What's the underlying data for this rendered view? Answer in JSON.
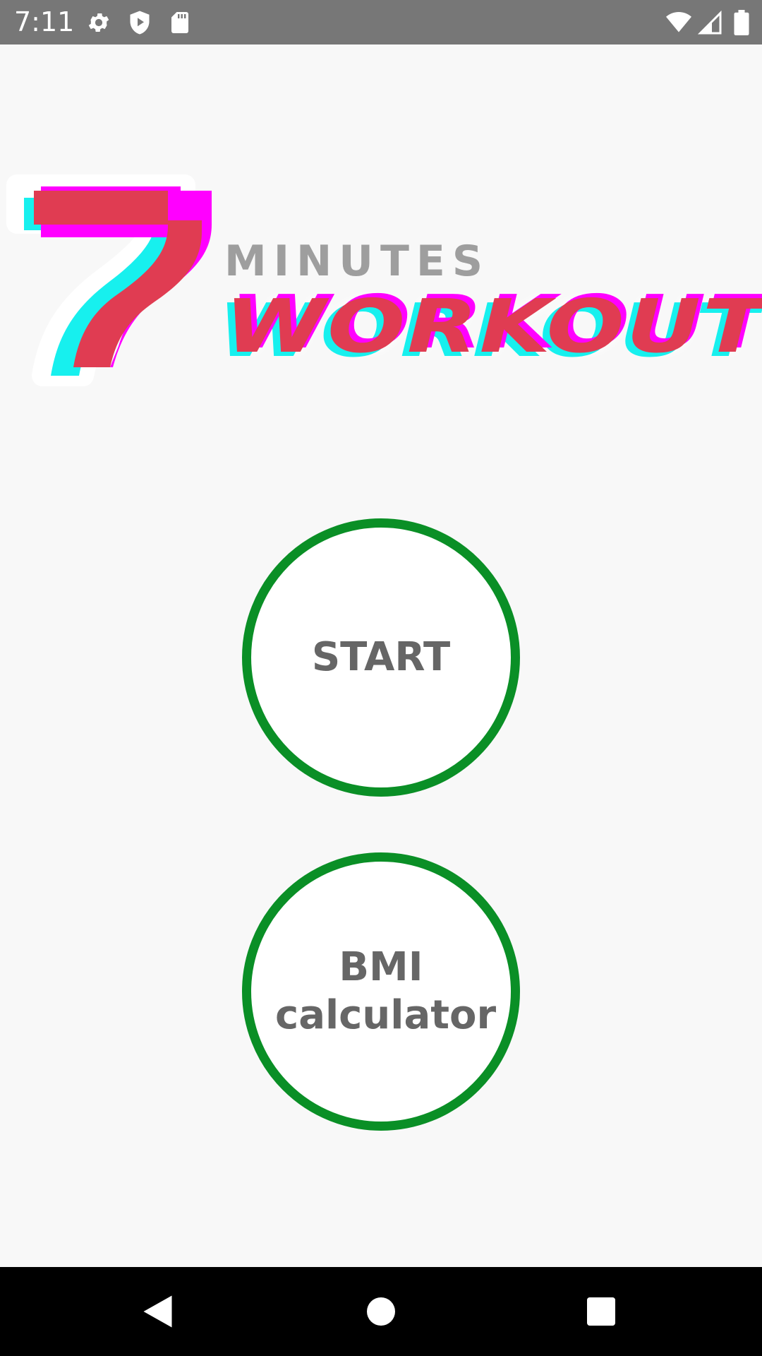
{
  "status_bar": {
    "time": "7:11",
    "left_icons": [
      "gear-icon",
      "shield-play-icon",
      "sd-card-icon"
    ],
    "right_icons": [
      "wifi-icon",
      "cell-signal-icon",
      "battery-icon"
    ]
  },
  "logo": {
    "number": "7",
    "minutes_text": "MINUTES",
    "workout_text": "WORKOUT",
    "colors": {
      "primary": "#e03c52",
      "magenta": "#ff00ff",
      "cyan": "#17f0ee",
      "gray": "#9e9e9e"
    }
  },
  "buttons": {
    "start_label": "START",
    "bmi_label": "BMI calculator",
    "border_color": "#0a8f26"
  },
  "nav_bar": {
    "icons": [
      "back-icon",
      "home-icon",
      "recents-icon"
    ]
  }
}
